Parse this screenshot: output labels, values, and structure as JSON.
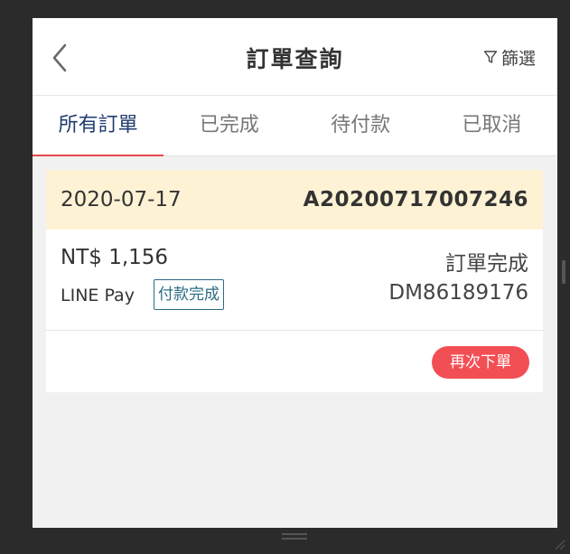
{
  "header": {
    "title": "訂單查詢",
    "filter_label": "篩選",
    "back_icon": "chevron-left-icon",
    "filter_icon": "filter-funnel-icon"
  },
  "tabs": [
    {
      "label": "所有訂單",
      "active": true
    },
    {
      "label": "已完成",
      "active": false
    },
    {
      "label": "待付款",
      "active": false
    },
    {
      "label": "已取消",
      "active": false
    }
  ],
  "order": {
    "date": "2020-07-17",
    "order_number": "A20200717007246",
    "amount": "NT$ 1,156",
    "status": "訂單完成",
    "payment_method": "LINE Pay",
    "payment_status": "付款完成",
    "shipment_number": "DM86189176",
    "reorder_label": "再次下單"
  },
  "colors": {
    "accent_red": "#f24f55",
    "tab_active": "#1f3c6e",
    "tab_underline": "#e8474a",
    "card_head_bg": "#fdf2d4",
    "badge_border": "#2b6c84"
  }
}
